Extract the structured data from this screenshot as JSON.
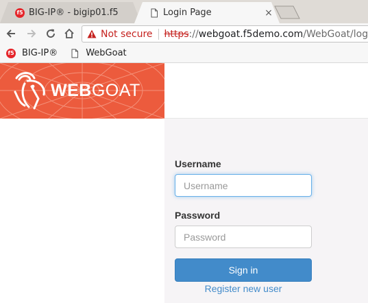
{
  "browser": {
    "tabs": [
      {
        "title": "BIG-IP® - bigip01.f5",
        "icon": "f5-logo-icon",
        "active": false
      },
      {
        "title": "Login Page",
        "icon": "page-icon",
        "active": true
      }
    ],
    "tab_close_glyph": "×",
    "address_bar": {
      "security_label": "Not secure",
      "url_scheme": "https",
      "url_separator": "://",
      "url_host": "webgoat.f5demo.com",
      "url_path": "/WebGoat/login"
    },
    "bookmarks": [
      {
        "label": "BIG-IP®",
        "icon": "f5-logo-icon"
      },
      {
        "label": "WebGoat",
        "icon": "page-icon"
      }
    ],
    "f5_logo_text": "f5"
  },
  "page": {
    "brand": {
      "bold": "WEB",
      "light": "GOAT"
    },
    "login": {
      "username_label": "Username",
      "username_placeholder": "Username",
      "username_value": "",
      "password_label": "Password",
      "password_placeholder": "Password",
      "password_value": "",
      "signin_label": "Sign in",
      "register_label": "Register new user"
    }
  },
  "colors": {
    "brand_orange": "#ec5b3d",
    "signin_blue": "#428bca",
    "warning_red": "#c5221f"
  }
}
